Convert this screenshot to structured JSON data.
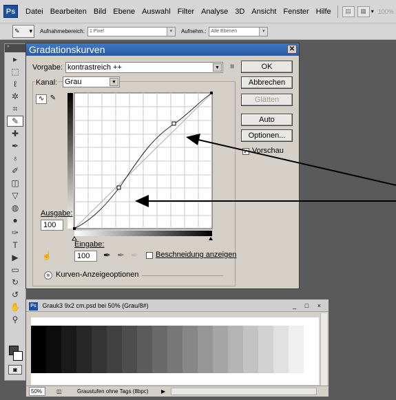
{
  "menubar": {
    "logo": "Ps",
    "items": [
      "Datei",
      "Bearbeiten",
      "Bild",
      "Ebene",
      "Auswahl",
      "Filter",
      "Analyse",
      "3D",
      "Ansicht",
      "Fenster",
      "Hilfe"
    ],
    "zoom": "100%"
  },
  "optionsbar": {
    "sample_size_label": "Aufnahmebereich:",
    "sample_size_value": "1 Pixel",
    "sample_label": "Aufnehm.:",
    "sample_value": "Alle Ebenen"
  },
  "toolbox": {
    "tools": [
      "move-icon",
      "marquee-icon",
      "lasso-icon",
      "magic-wand-icon",
      "crop-icon",
      "eyedropper-icon",
      "healing-brush-icon",
      "brush-icon",
      "clone-stamp-icon",
      "history-brush-icon",
      "eraser-icon",
      "paint-bucket-icon",
      "blur-icon",
      "dodge-icon",
      "pen-icon",
      "text-icon",
      "path-select-icon",
      "shape-icon",
      "3d-rotate-icon",
      "3d-orbit-icon",
      "hand-icon",
      "zoom-icon"
    ],
    "tool_glyphs": [
      "▸",
      "⬚",
      "ℓ",
      "✲",
      "⌗",
      "✎",
      "✚",
      "✒",
      "♁",
      "✐",
      "◫",
      "▽",
      "◍",
      "●",
      "✑",
      "T",
      "▶",
      "▭",
      "↻",
      "↺",
      "✋",
      "⚲"
    ]
  },
  "dialog": {
    "title": "Gradationskurven",
    "preset_label": "Vorgabe:",
    "preset_value": "kontrastreich ++",
    "channel_label": "Kanal:",
    "channel_value": "Grau",
    "output_label": "Ausgabe:",
    "output_value": "100",
    "input_label": "Eingabe:",
    "input_value": "100",
    "clipping_label": "Beschneidung anzeigen",
    "clipping_checked": false,
    "curve_options_label": "Kurven-Anzeigeoptionen",
    "buttons": {
      "ok": "OK",
      "cancel": "Abbrechen",
      "smooth": "Glätten",
      "auto": "Auto",
      "options": "Optionen..."
    },
    "preview_label": "Vorschau",
    "preview_checked": true
  },
  "document": {
    "title": "Grauk3 9x2 cm.psd bei 50% (Grau/8#)",
    "controls": "_ □ ×",
    "zoom": "50%",
    "status": "Graustufen ohne Tags (8bpc)",
    "gradient_steps": [
      "#000000",
      "#0d0d0d",
      "#1a1a1a",
      "#272727",
      "#343434",
      "#414141",
      "#4e4e4e",
      "#5c5c5c",
      "#6a6a6a",
      "#787878",
      "#878787",
      "#969696",
      "#a5a5a5",
      "#b4b4b4",
      "#c3c3c3",
      "#d2d2d2",
      "#e1e1e1",
      "#f0f0f0",
      "#ffffff"
    ]
  }
}
